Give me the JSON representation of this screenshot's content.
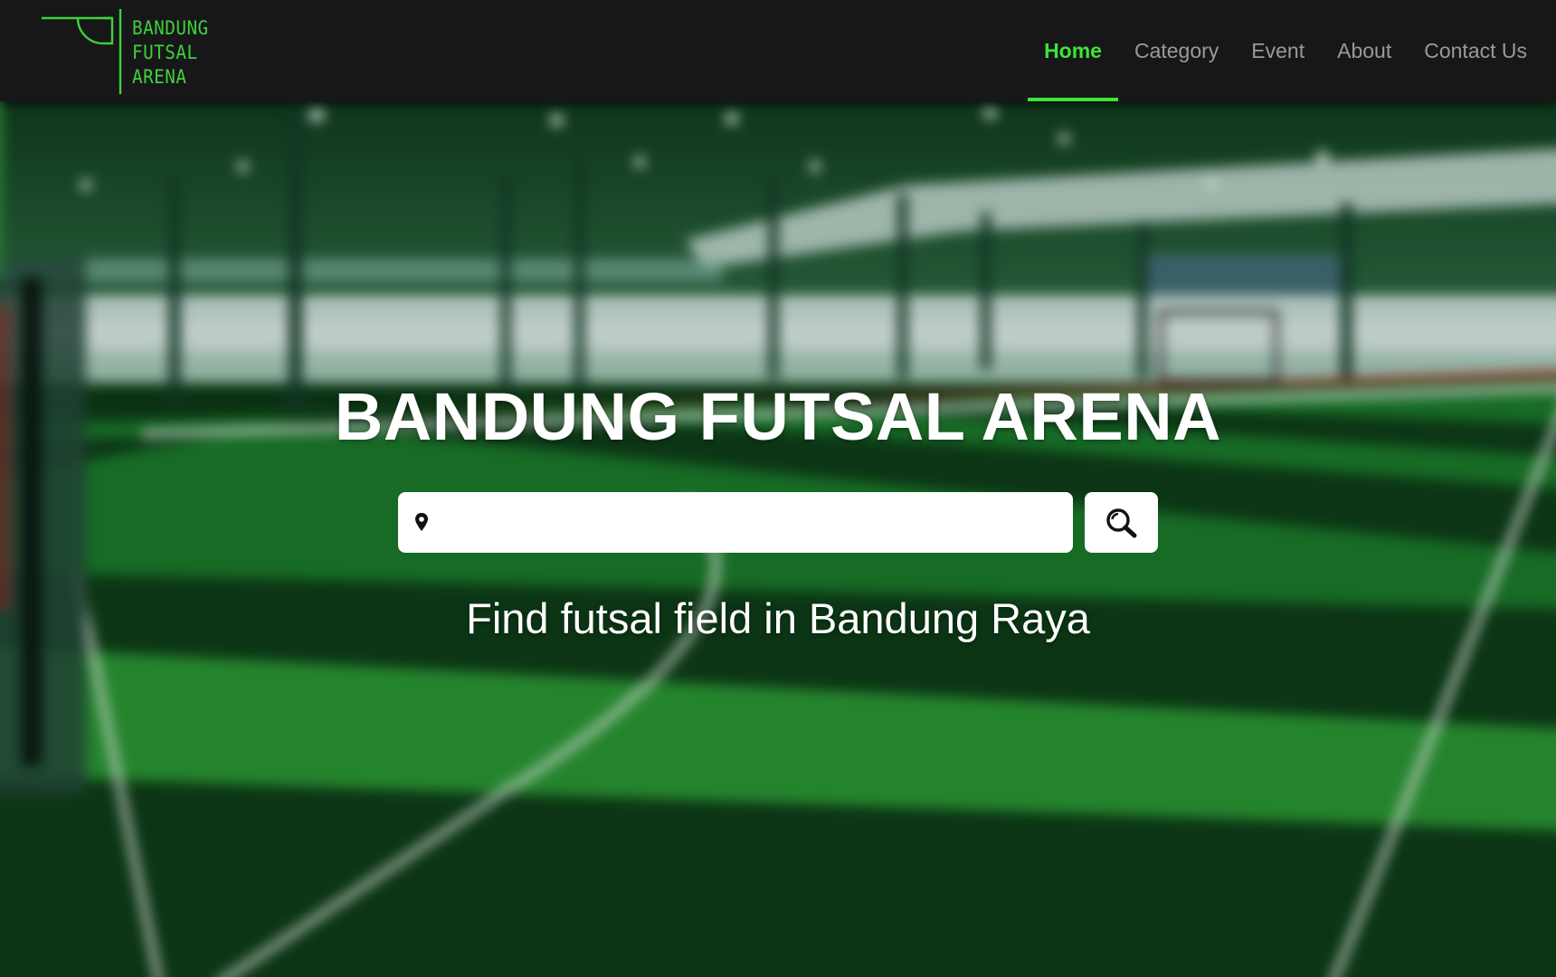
{
  "brand": {
    "logo_lines": [
      "BANDUNG",
      "FUTSAL",
      "ARENA"
    ],
    "accent_color": "#3ee43a"
  },
  "nav": {
    "items": [
      {
        "label": "Home",
        "active": true
      },
      {
        "label": "Category",
        "active": false
      },
      {
        "label": "Event",
        "active": false
      },
      {
        "label": "About",
        "active": false
      },
      {
        "label": "Contact Us",
        "active": false
      }
    ]
  },
  "hero": {
    "title": "BANDUNG FUTSAL ARENA",
    "search": {
      "value": "",
      "placeholder": "",
      "location_icon": "map-pin-icon",
      "button_icon": "search-icon"
    },
    "tagline_prefix": "Find futsal field in ",
    "tagline_highlight": "Bandung Raya"
  }
}
